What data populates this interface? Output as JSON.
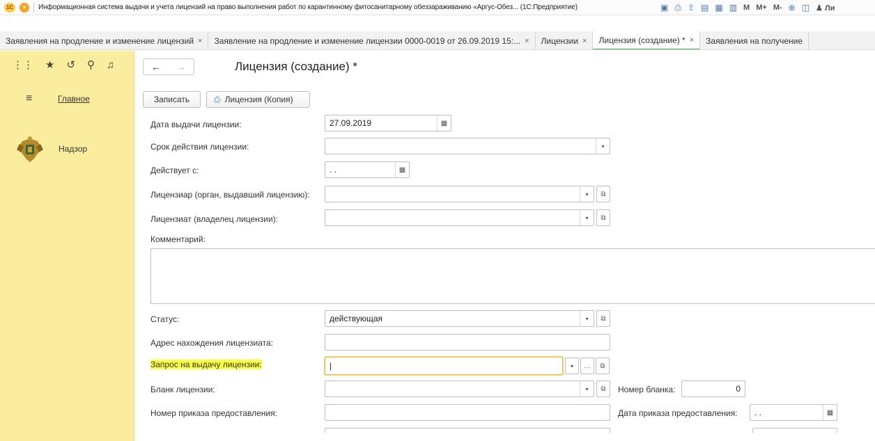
{
  "titlebar": {
    "title": "Информационная система выдачи и учета лицензий на право выполнения работ по карантинному фитосанитарному обеззараживанию «Аргус-Обез... (1С:Предприятие)",
    "shortcuts": [
      "M",
      "M+",
      "M-"
    ],
    "user": "Ли"
  },
  "tabs": [
    {
      "label": "Заявления на продление и изменение лицензий",
      "active": false
    },
    {
      "label": "Заявление на продление и изменение лицензии 0000-0019 от 26.09.2019 15:...",
      "active": false
    },
    {
      "label": "Лицензии",
      "active": false
    },
    {
      "label": "Лицензия (создание) *",
      "active": true
    },
    {
      "label": "Заявления на получение",
      "active": false
    }
  ],
  "sidebar": {
    "main_link": "Главное",
    "section": "Надзор"
  },
  "form": {
    "title": "Лицензия (создание) *",
    "save_label": "Записать",
    "print_label": "Лицензия (Копия)",
    "fields": {
      "issue_date": {
        "label": "Дата выдачи лицензии:",
        "value": "27.09.2019"
      },
      "validity": {
        "label": "Срок действия лицензии:",
        "value": ""
      },
      "valid_from": {
        "label": "Действует с:",
        "value": " .  ."
      },
      "licensor": {
        "label": "Лицензиар (орган, выдавший лицензию):",
        "value": ""
      },
      "licensee": {
        "label": "Лицензиат (владелец лицензии):",
        "value": ""
      },
      "comment": {
        "label": "Комментарий:",
        "value": ""
      },
      "status": {
        "label": "Статус:",
        "value": "действующая"
      },
      "address": {
        "label": "Адрес нахождения лицензиата:",
        "value": ""
      },
      "request": {
        "label": "Запрос на выдачу лицензии:",
        "value": ""
      },
      "blank": {
        "label": "Бланк лицензии:",
        "value": ""
      },
      "blank_number": {
        "label": "Номер бланка:",
        "value": "0"
      },
      "order_number": {
        "label": "Номер приказа предоставления:",
        "value": ""
      },
      "order_date": {
        "label": "Дата приказа предоставления:",
        "value": " .  ."
      }
    }
  }
}
